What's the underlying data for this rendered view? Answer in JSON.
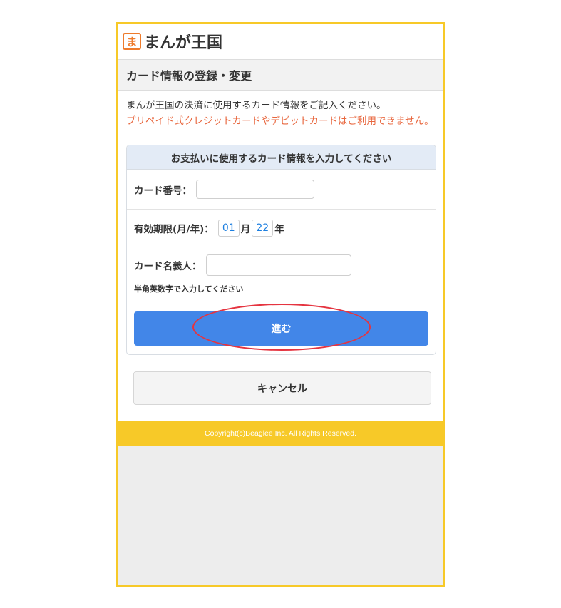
{
  "header": {
    "logo_mark": "ま",
    "logo_text": "まんが王国"
  },
  "page_title": "カード情報の登録・変更",
  "intro": {
    "normal": "まんが王国の決済に使用するカード情報をご記入ください。",
    "warning": "プリペイド式クレジットカードやデビットカードはご利用できません。"
  },
  "form": {
    "heading": "お支払いに使用するカード情報を入力してください",
    "card_number_label": "カード番号：",
    "card_number_value": "",
    "expiry_label": "有効期限(月/年)：",
    "expiry_month": "01",
    "month_unit": "月",
    "expiry_year": "22",
    "year_unit": "年",
    "holder_label": "カード名義人：",
    "holder_value": "",
    "holder_hint": "半角英数字で入力してください",
    "submit_label": "進む"
  },
  "cancel_label": "キャンセル",
  "footer": {
    "copyright": "Copyright(c)Beaglee Inc. All Rights Reserved."
  },
  "colors": {
    "accent_yellow": "#f7c928",
    "primary_blue": "#4286e8",
    "warning_orange": "#e8663d",
    "highlight_red": "#e53440"
  }
}
